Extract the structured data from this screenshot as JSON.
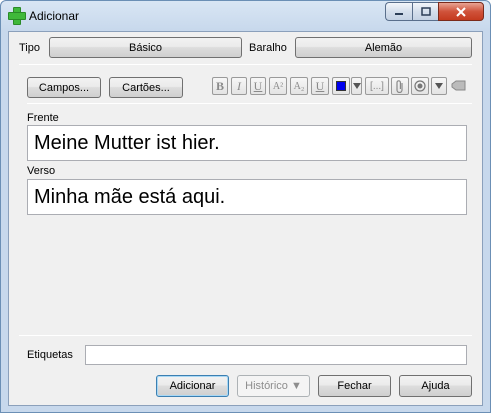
{
  "window": {
    "title": "Adicionar",
    "minimize_icon": "minimize-icon",
    "maximize_icon": "maximize-icon",
    "close_icon": "close-icon"
  },
  "top_bar": {
    "type_label": "Tipo",
    "type_value": "Básico",
    "deck_label": "Baralho",
    "deck_value": "Alemão"
  },
  "toolbar": {
    "fields_button": "Campos...",
    "cards_button": "Cartões...",
    "format_buttons": {
      "bold": "B",
      "italic": "I",
      "underline": "U",
      "superscript": "A²",
      "subscript": "A₂",
      "clear_format": "U",
      "cloze": "[...]"
    },
    "text_color": "#0000ee"
  },
  "fields": [
    {
      "name": "Frente",
      "value": "Meine Mutter ist hier."
    },
    {
      "name": "Verso",
      "value": "Minha mãe está aqui."
    }
  ],
  "tags": {
    "label": "Etiquetas",
    "value": ""
  },
  "buttons": {
    "add": "Adicionar",
    "history": "Histórico ▼",
    "close": "Fechar",
    "help": "Ajuda"
  }
}
